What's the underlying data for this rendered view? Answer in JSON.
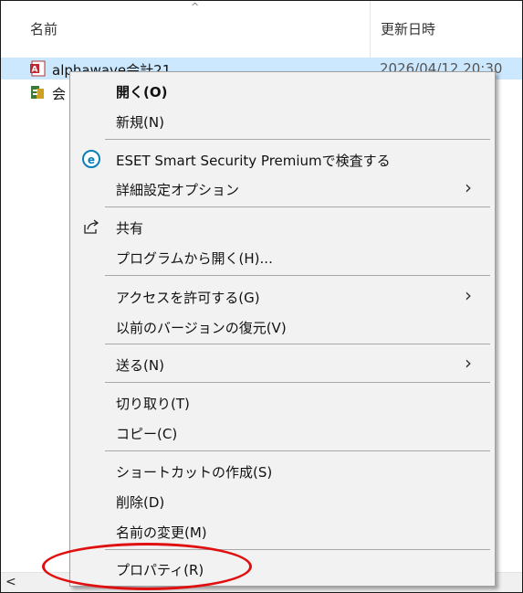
{
  "explorer": {
    "columns": {
      "name": "名前",
      "date": "更新日時"
    },
    "files": [
      {
        "name": "alphawave会計21",
        "date": "2026/04/12 20:30"
      },
      {
        "name": "会",
        "date": ""
      }
    ]
  },
  "context_menu": {
    "items": [
      {
        "label": "開く(O)"
      },
      {
        "label": "新規(N)"
      },
      {
        "label": "ESET Smart Security Premiumで検査する",
        "icon": "eset-icon"
      },
      {
        "label": "詳細設定オプション",
        "submenu": true
      },
      {
        "label": "共有",
        "icon": "share-icon"
      },
      {
        "label": "プログラムから開く(H)..."
      },
      {
        "label": "アクセスを許可する(G)",
        "submenu": true
      },
      {
        "label": "以前のバージョンの復元(V)"
      },
      {
        "label": "送る(N)",
        "submenu": true
      },
      {
        "label": "切り取り(T)"
      },
      {
        "label": "コピー(C)"
      },
      {
        "label": "ショートカットの作成(S)"
      },
      {
        "label": "削除(D)"
      },
      {
        "label": "名前の変更(M)"
      },
      {
        "label": "プロパティ(R)"
      }
    ]
  },
  "colors": {
    "selection": "#cce8ff",
    "menu_bg": "#f2f2f2",
    "highlight": "#e01010",
    "eset": "#0a7fb8"
  },
  "scrollbar": {
    "left_arrow": "<"
  }
}
